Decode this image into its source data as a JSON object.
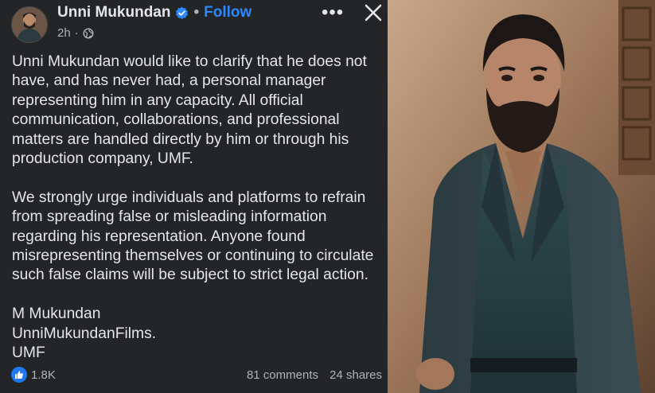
{
  "post": {
    "author": "Unni Mukundan",
    "separator": "•",
    "follow_label": "Follow",
    "time": "2h",
    "privacy_icon": "globe-icon",
    "more_label": "•••",
    "paragraphs": [
      "Unni Mukundan would like to clarify that he does not\nhave, and has never had, a personal manager\nrepresenting him in any capacity. All official\ncommunication, collaborations, and professional\nmatters are handled directly by him or through his\nproduction company, UMF.",
      "We strongly urge individuals and platforms to refrain\nfrom spreading false or misleading information\nregarding his representation. Anyone found\nmisrepresenting themselves or continuing to circulate\nsuch false claims will be subject to strict legal action."
    ],
    "signature": "M Mukundan\nUnniMukundanFilms.\nUMF",
    "reactions": "1.8K",
    "comments": "81 comments",
    "shares": "24 shares"
  },
  "colors": {
    "panel_bg": "#242526",
    "text": "#e4e6eb",
    "secondary_text": "#b0b3b8",
    "accent": "#2d88ff",
    "like": "#2078f4"
  }
}
